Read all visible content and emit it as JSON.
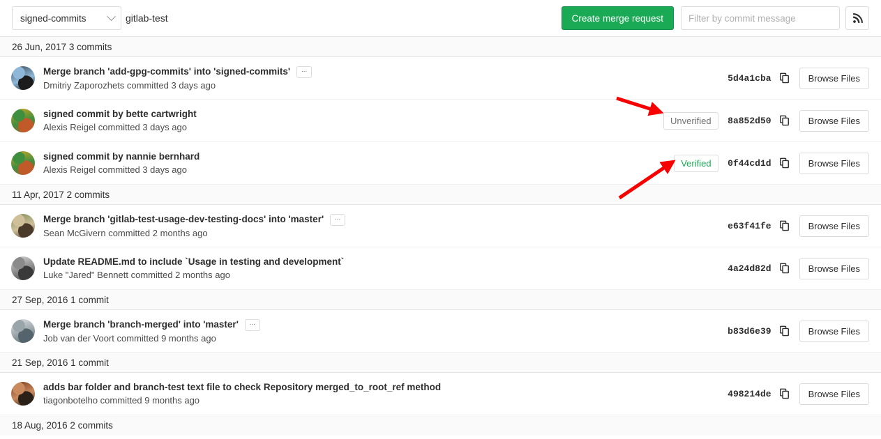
{
  "toolbar": {
    "branch_selected": "signed-commits",
    "branch_chevron_icon": "chevron-down-icon",
    "repo_name": "gitlab-test",
    "create_mr_label": "Create merge request",
    "filter_placeholder": "Filter by commit message",
    "filter_value": "",
    "rss_icon": "rss-feed-icon"
  },
  "accent": {
    "green": "#1aaa55",
    "grey_text": "#707070",
    "arrow_red": "#f60000"
  },
  "groups": [
    {
      "date_label": "26 Jun, 2017 3 commits",
      "commits": [
        {
          "title": "Merge branch 'add-gpg-commits' into 'signed-commits'",
          "has_ellipsis": true,
          "ellipsis_label": "...",
          "meta": "Dmitriy Zaporozhets committed 3 days ago",
          "signature": null,
          "sha": "5d4a1cba",
          "copy_icon": "copy-icon",
          "browse_label": "Browse Files",
          "avatar_colors": [
            "#3a4a5a",
            "#8fb8d8",
            "#1c1c1c"
          ]
        },
        {
          "title": "signed commit by bette cartwright",
          "has_ellipsis": false,
          "ellipsis_label": "",
          "meta": "Alexis Reigel committed 3 days ago",
          "signature": "Unverified",
          "signature_state": "unverified",
          "sha": "8a852d50",
          "copy_icon": "copy-icon",
          "browse_label": "Browse Files",
          "avatar_colors": [
            "#d9a520",
            "#3f8f3f",
            "#c05a28"
          ]
        },
        {
          "title": "signed commit by nannie bernhard",
          "has_ellipsis": false,
          "ellipsis_label": "",
          "meta": "Alexis Reigel committed 3 days ago",
          "signature": "Verified",
          "signature_state": "verified",
          "sha": "0f44cd1d",
          "copy_icon": "copy-icon",
          "browse_label": "Browse Files",
          "avatar_colors": [
            "#d9a520",
            "#3f8f3f",
            "#c05a28"
          ]
        }
      ]
    },
    {
      "date_label": "11 Apr, 2017 2 commits",
      "commits": [
        {
          "title": "Merge branch 'gitlab-test-usage-dev-testing-docs' into 'master'",
          "has_ellipsis": true,
          "ellipsis_label": "...",
          "meta": "Sean McGivern committed 2 months ago",
          "signature": null,
          "sha": "e63f41fe",
          "copy_icon": "copy-icon",
          "browse_label": "Browse Files",
          "avatar_colors": [
            "#7d8a5a",
            "#cfc09a",
            "#4a3a2a"
          ]
        },
        {
          "title": "Update README.md to include `Usage in testing and development`",
          "has_ellipsis": false,
          "ellipsis_label": "",
          "meta": "Luke \"Jared\" Bennett committed 2 months ago",
          "signature": null,
          "sha": "4a24d82d",
          "copy_icon": "copy-icon",
          "browse_label": "Browse Files",
          "avatar_colors": [
            "#d6d6d6",
            "#8a8a8a",
            "#3a3a3a"
          ]
        }
      ]
    },
    {
      "date_label": "27 Sep, 2016 1 commit",
      "commits": [
        {
          "title": "Merge branch 'branch-merged' into 'master'",
          "has_ellipsis": true,
          "ellipsis_label": "...",
          "meta": "Job van der Voort committed 9 months ago",
          "signature": null,
          "sha": "b83d6e39",
          "copy_icon": "copy-icon",
          "browse_label": "Browse Files",
          "avatar_colors": [
            "#dfe4e6",
            "#9aa5aa",
            "#55646c"
          ]
        }
      ]
    },
    {
      "date_label": "21 Sep, 2016 1 commit",
      "commits": [
        {
          "title": "adds bar folder and branch-test text file to check Repository merged_to_root_ref method",
          "has_ellipsis": false,
          "ellipsis_label": "",
          "meta": "tiagonbotelho committed 9 months ago",
          "signature": null,
          "sha": "498214de",
          "copy_icon": "copy-icon",
          "browse_label": "Browse Files",
          "avatar_colors": [
            "#7a3b1e",
            "#c98a5e",
            "#2a2018"
          ]
        }
      ]
    },
    {
      "date_label": "18 Aug, 2016 2 commits",
      "commits": []
    }
  ],
  "annotations": [
    {
      "name": "arrow-to-unverified-badge",
      "color": "#f60000"
    },
    {
      "name": "arrow-to-verified-badge",
      "color": "#f60000"
    }
  ]
}
